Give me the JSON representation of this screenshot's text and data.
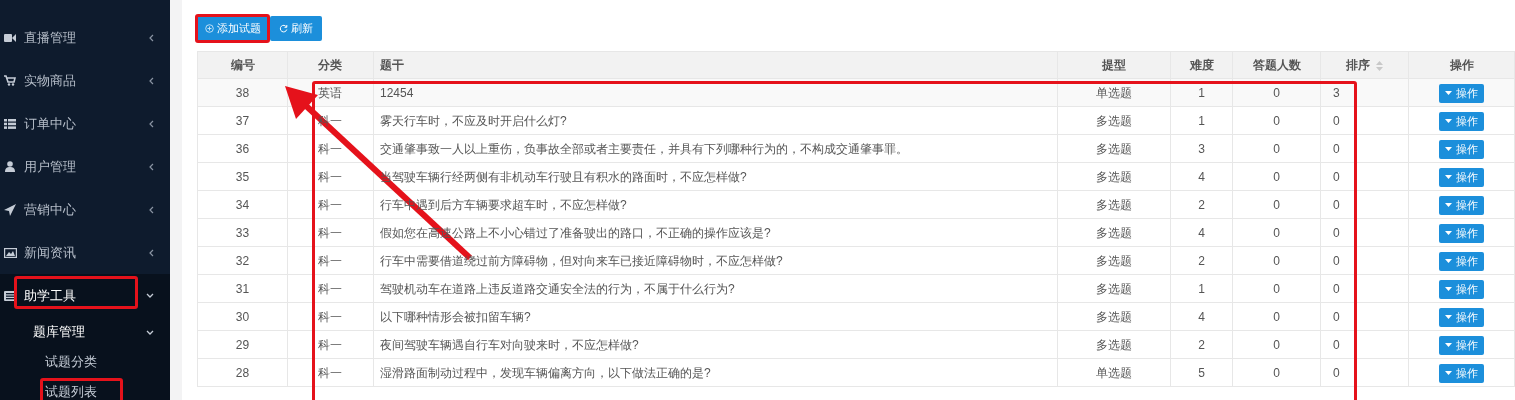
{
  "sidebar": {
    "items": [
      {
        "label": "直播管理",
        "expanded": false
      },
      {
        "label": "实物商品",
        "expanded": false
      },
      {
        "label": "订单中心",
        "expanded": false
      },
      {
        "label": "用户管理",
        "expanded": false
      },
      {
        "label": "营销中心",
        "expanded": false
      },
      {
        "label": "新闻资讯",
        "expanded": false
      },
      {
        "label": "助学工具",
        "expanded": true,
        "children": [
          {
            "label": "题库管理",
            "expanded": true,
            "children": [
              {
                "label": "试题分类"
              },
              {
                "label": "试题列表"
              }
            ]
          }
        ]
      }
    ]
  },
  "toolbar": {
    "buttons": [
      {
        "kind": "add",
        "label": "添加试题"
      },
      {
        "kind": "refresh",
        "label": "刷新"
      }
    ]
  },
  "table": {
    "columns": [
      "编号",
      "分类",
      "题干",
      "提型",
      "难度",
      "答题人数",
      "排序",
      "操作"
    ],
    "rows": [
      {
        "id": "38",
        "category": "英语",
        "stem": "12454",
        "type": "单选题",
        "difficulty": "1",
        "answered": "0",
        "order": "3",
        "action": "操作"
      },
      {
        "id": "37",
        "category": "科一",
        "stem": "雾天行车时，不应及时开启什么灯?",
        "type": "多选题",
        "difficulty": "1",
        "answered": "0",
        "order": "0",
        "action": "操作"
      },
      {
        "id": "36",
        "category": "科一",
        "stem": "交通肇事致一人以上重伤，负事故全部或者主要责任，并具有下列哪种行为的，不构成交通肇事罪。",
        "type": "多选题",
        "difficulty": "3",
        "answered": "0",
        "order": "0",
        "action": "操作"
      },
      {
        "id": "35",
        "category": "科一",
        "stem": "当驾驶车辆行经两侧有非机动车行驶且有积水的路面时，不应怎样做?",
        "type": "多选题",
        "difficulty": "4",
        "answered": "0",
        "order": "0",
        "action": "操作"
      },
      {
        "id": "34",
        "category": "科一",
        "stem": "行车中遇到后方车辆要求超车时，不应怎样做?",
        "type": "多选题",
        "difficulty": "2",
        "answered": "0",
        "order": "0",
        "action": "操作"
      },
      {
        "id": "33",
        "category": "科一",
        "stem": "假如您在高速公路上不小心错过了准备驶出的路口，不正确的操作应该是?",
        "type": "多选题",
        "difficulty": "4",
        "answered": "0",
        "order": "0",
        "action": "操作"
      },
      {
        "id": "32",
        "category": "科一",
        "stem": "行车中需要借道绕过前方障碍物，但对向来车已接近障碍物时，不应怎样做?",
        "type": "多选题",
        "difficulty": "2",
        "answered": "0",
        "order": "0",
        "action": "操作"
      },
      {
        "id": "31",
        "category": "科一",
        "stem": "驾驶机动车在道路上违反道路交通安全法的行为，不属于什么行为?",
        "type": "多选题",
        "difficulty": "1",
        "answered": "0",
        "order": "0",
        "action": "操作"
      },
      {
        "id": "30",
        "category": "科一",
        "stem": "以下哪种情形会被扣留车辆?",
        "type": "多选题",
        "difficulty": "4",
        "answered": "0",
        "order": "0",
        "action": "操作"
      },
      {
        "id": "29",
        "category": "科一",
        "stem": "夜间驾驶车辆遇自行车对向驶来时，不应怎样做?",
        "type": "多选题",
        "difficulty": "2",
        "answered": "0",
        "order": "0",
        "action": "操作"
      },
      {
        "id": "28",
        "category": "科一",
        "stem": "湿滑路面制动过程中，发现车辆偏离方向，以下做法正确的是?",
        "type": "单选题",
        "difficulty": "5",
        "answered": "0",
        "order": "0",
        "action": "操作"
      }
    ]
  }
}
